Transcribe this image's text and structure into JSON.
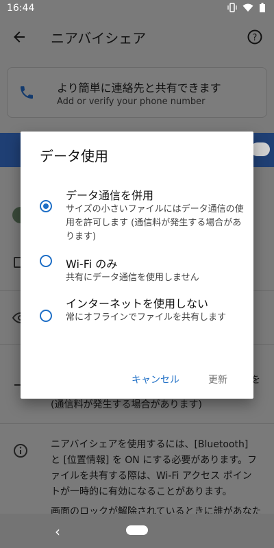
{
  "status_bar": {
    "time": "16:44"
  },
  "app_bar": {
    "title": "ニアバイシェア"
  },
  "card": {
    "title": "より簡単に連絡先と共有できます",
    "subtitle": "Add or verify your phone number"
  },
  "background": {
    "row_partial_text": "(通信料が発生する場合があります)",
    "row_partial_suffix": "を",
    "info_text_1": "ニアバイシェアを使用するには、[Bluetooth] と [位置情報] を ON にする必要があります。ファイルを共有する際は、Wi-Fi アクセス ポイントが一時的に有効になることがあります。",
    "info_text_2": "画面のロックが解除されているときに誰があなた"
  },
  "dialog": {
    "title": "データ使用",
    "options": [
      {
        "label": "データ通信を併用",
        "desc": "サイズの小さいファイルにはデータ通信の使用を許可します (通信料が発生する場合があります)",
        "selected": true
      },
      {
        "label": "Wi-Fi のみ",
        "desc": "共有にデータ通信を使用しません",
        "selected": false
      },
      {
        "label": "インターネットを使用しない",
        "desc": "常にオフラインでファイルを共有します",
        "selected": false
      }
    ],
    "cancel_label": "キャンセル",
    "update_label": "更新"
  },
  "colors": {
    "accent": "#1f6fc6",
    "scrim": "#7a7a7a",
    "blue_bar": "#1f3f74"
  },
  "icons": {
    "status": [
      "vibrate-icon",
      "wifi-icon",
      "battery-icon"
    ],
    "back": "arrow-left-icon",
    "help": "help-circle-icon",
    "phone": "phone-icon",
    "info": "info-icon"
  }
}
